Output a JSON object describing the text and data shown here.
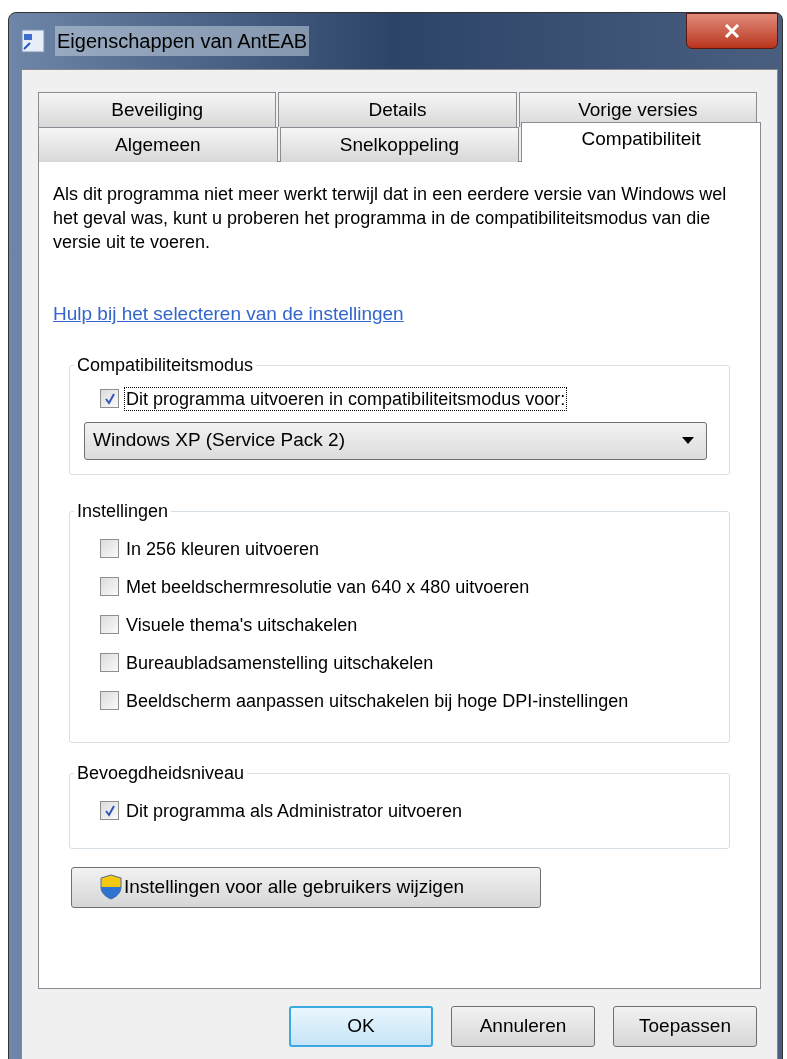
{
  "window": {
    "title": "Eigenschappen van AntEAB"
  },
  "tab_rows": [
    [
      {
        "label": "Beveiliging",
        "selected": false
      },
      {
        "label": "Details",
        "selected": false
      },
      {
        "label": "Vorige versies",
        "selected": false
      }
    ],
    [
      {
        "label": "Algemeen",
        "selected": false
      },
      {
        "label": "Snelkoppeling",
        "selected": false
      },
      {
        "label": "Compatibiliteit",
        "selected": true
      }
    ]
  ],
  "intro": "Als dit programma niet meer werkt terwijl dat in een eerdere versie van Windows wel het geval was, kunt u proberen het programma in de compatibiliteitsmodus van die versie uit te voeren.",
  "help_link": "Hulp bij het selecteren van de instellingen",
  "groups": [
    {
      "title": "Compatibiliteitsmodus",
      "options": [
        {
          "label": "Dit programma uitvoeren in compatibiliteitsmodus voor:",
          "checked": true,
          "focused": true
        }
      ],
      "dropdown": {
        "value": "Windows XP (Service Pack 2)"
      }
    },
    {
      "title": "Instellingen",
      "options": [
        {
          "label": "In 256 kleuren uitvoeren",
          "checked": false,
          "focused": false
        },
        {
          "label": "Met beeldschermresolutie van 640 x 480 uitvoeren",
          "checked": false,
          "focused": false
        },
        {
          "label": "Visuele thema's uitschakelen",
          "checked": false,
          "focused": false
        },
        {
          "label": "Bureaubladsamenstelling uitschakelen",
          "checked": false,
          "focused": false
        },
        {
          "label": "Beeldscherm aanpassen uitschakelen bij hoge DPI-instellingen",
          "checked": false,
          "focused": false
        }
      ]
    },
    {
      "title": "Bevoegdheidsniveau",
      "options": [
        {
          "label": "Dit programma als Administrator uitvoeren",
          "checked": true,
          "focused": false
        }
      ]
    }
  ],
  "all_users_button": "Instellingen voor alle gebruikers wijzigen",
  "buttons": [
    {
      "label": "OK",
      "default": true
    },
    {
      "label": "Annuleren",
      "default": false
    },
    {
      "label": "Toepassen",
      "default": false
    }
  ]
}
